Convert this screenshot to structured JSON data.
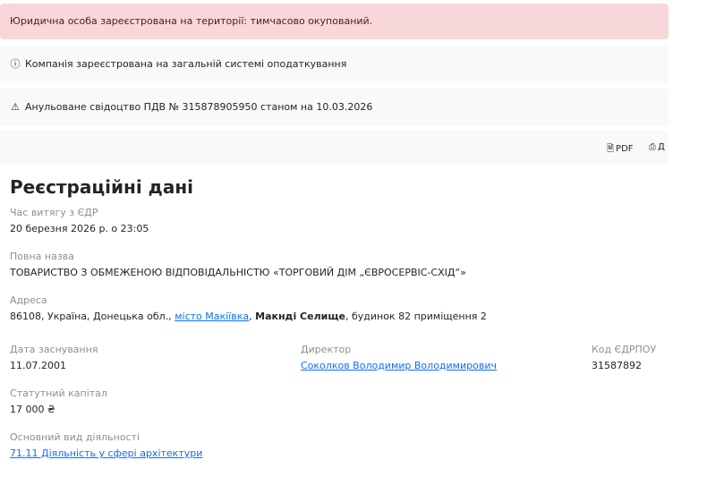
{
  "alerts": {
    "occupied": "Юридична особа зареєстрована на території: тимчасово окупований.",
    "tax_system": "Компанія зареєстрована на загальній системі оподаткування",
    "vat": "Анульоване свідоцтво ПДВ № 315878905950 станом на 10.03.2026"
  },
  "icons": {
    "info": "ⓘ",
    "warning": "⚠",
    "pdf": "🗎",
    "print": "⎙"
  },
  "toolbar": {
    "pdf_label": "PDF",
    "print_label": "Д"
  },
  "section_title": "Реєстраційні дані",
  "extract_time": {
    "label": "Час витягу з ЄДР",
    "value": "20 березня 2026 р. о 23:05"
  },
  "full_name": {
    "label": "Повна назва",
    "value": "ТОВАРИСТВО З ОБМЕЖЕНОЮ ВІДПОВІДАЛЬНІСТЮ «ТОРГОВИЙ ДІМ „ЄВРОСЕРВІС-СХІД“»"
  },
  "address": {
    "label": "Адреса",
    "prefix": "86108, Україна, Донецька обл., ",
    "city_link": "місто Макіївка",
    "sep": ", ",
    "settlement": "Макнді Селище",
    "suffix": ", будинок 82 приміщення 2"
  },
  "founded": {
    "label": "Дата заснування",
    "value": "11.07.2001"
  },
  "director": {
    "label": "Директор",
    "value": "Соколков Володимир Володимирович"
  },
  "edrpou": {
    "label": "Код ЄДРПОУ",
    "value": "31587892"
  },
  "capital": {
    "label": "Статутний капітал",
    "value": "17 000 ₴"
  },
  "activity": {
    "label": "Основний вид діяльності",
    "value": "71.11 Діяльність у сфері архітектури"
  }
}
